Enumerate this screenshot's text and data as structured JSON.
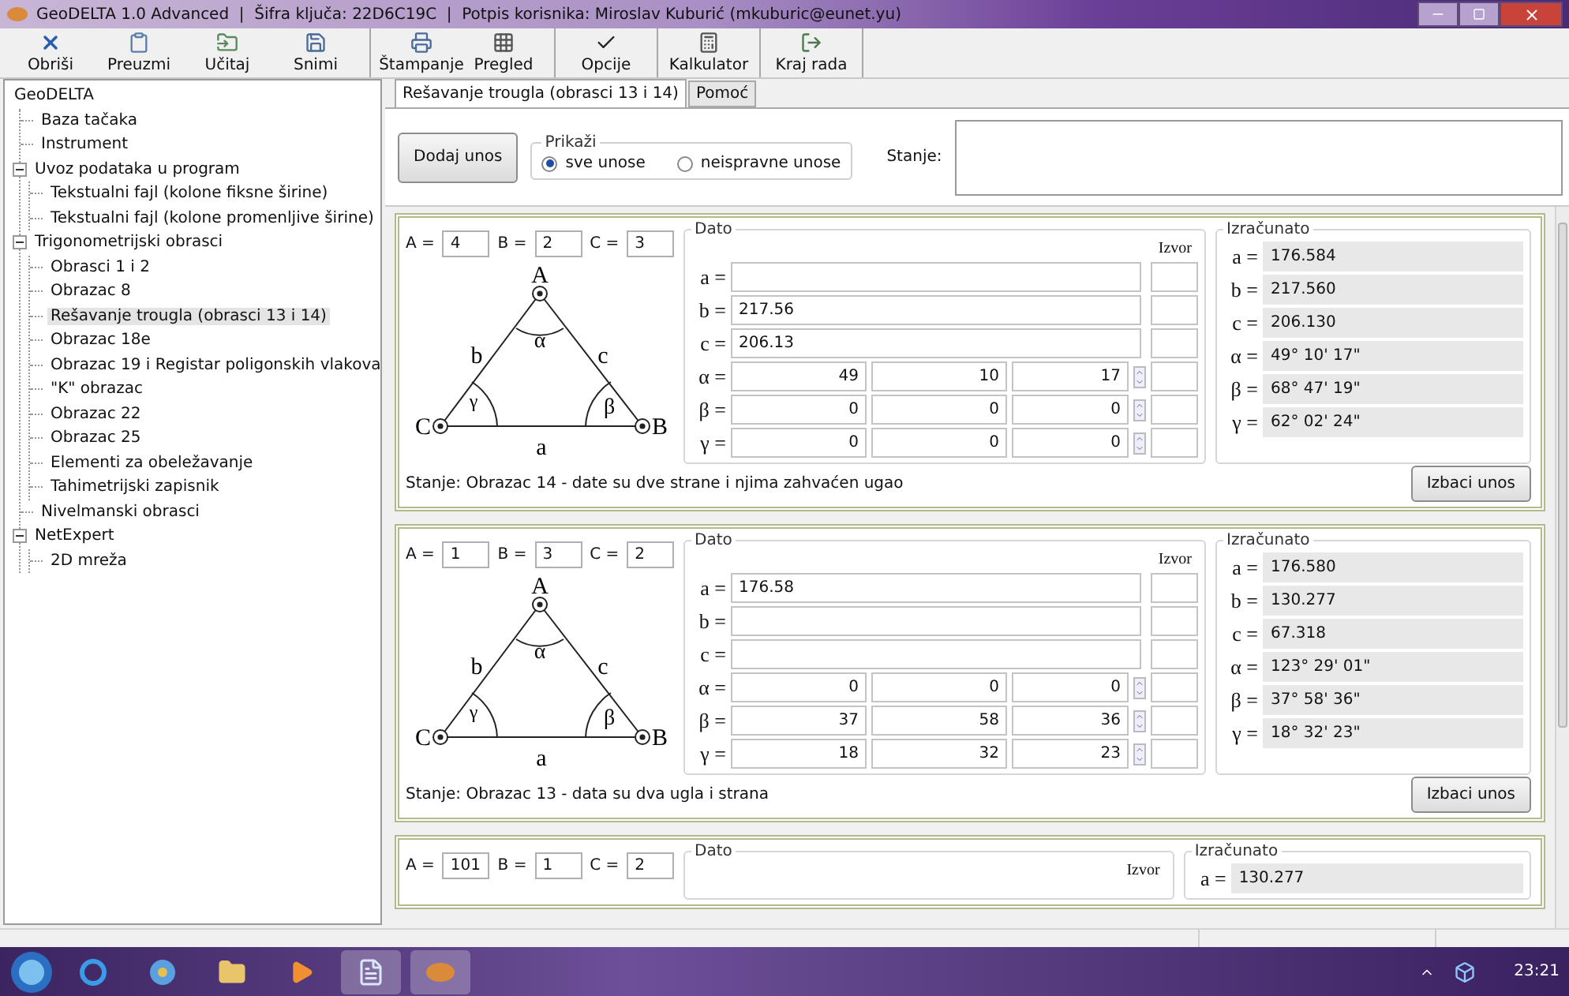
{
  "window": {
    "title": "GeoDELTA 1.0 Advanced  |  Šifra ključa: 22D6C19C  |  Potpis korisnika: Miroslav Kuburić (mkuburic@eunet.yu)"
  },
  "toolbar": {
    "groups": [
      {
        "buttons": [
          "Obriši",
          "Preuzmi",
          "Učitaj",
          "Snimi"
        ]
      },
      {
        "buttons": [
          "Štampanje",
          "Pregled"
        ]
      },
      {
        "buttons": [
          "Opcije"
        ]
      },
      {
        "buttons": [
          "Kalkulator"
        ]
      },
      {
        "buttons": [
          "Kraj rada"
        ]
      }
    ]
  },
  "tree": {
    "root": "GeoDELTA",
    "items": [
      {
        "label": "Baza tačaka",
        "selected": false
      },
      {
        "label": "Instrument",
        "selected": false
      },
      {
        "label": "Uvoz podataka u program",
        "selected": false,
        "expanded": true,
        "children": [
          {
            "label": "Tekstualni fajl (kolone fiksne širine)",
            "selected": false
          },
          {
            "label": "Tekstualni fajl (kolone promenljive širine)",
            "selected": false
          }
        ]
      },
      {
        "label": "Trigonometrijski obrasci",
        "selected": false,
        "expanded": true,
        "children": [
          {
            "label": "Obrasci 1 i 2",
            "selected": false
          },
          {
            "label": "Obrazac 8",
            "selected": false
          },
          {
            "label": "Rešavanje trougla (obrasci 13 i 14)",
            "selected": true
          },
          {
            "label": "Obrazac 18e",
            "selected": false
          },
          {
            "label": "Obrazac 19 i Registar poligonskih vlakova",
            "selected": false
          },
          {
            "label": "\"K\" obrazac",
            "selected": false
          },
          {
            "label": "Obrazac 22",
            "selected": false
          },
          {
            "label": "Obrazac 25",
            "selected": false
          },
          {
            "label": "Elementi za obeležavanje",
            "selected": false
          },
          {
            "label": "Tahimetrijski zapisnik",
            "selected": false
          }
        ]
      },
      {
        "label": "Nivelmanski obrasci",
        "selected": false
      },
      {
        "label": "NetExpert",
        "selected": false,
        "expanded": true,
        "children": [
          {
            "label": "2D mreža",
            "selected": false
          }
        ]
      }
    ]
  },
  "tabs": [
    {
      "label": "Rešavanje trougla (obrasci 13 i 14)",
      "selected": true
    },
    {
      "label": "Pomoć",
      "selected": false
    }
  ],
  "controls": {
    "add_button": "Dodaj unos",
    "show": {
      "legend": "Prikaži",
      "options": [
        {
          "label": "sve unose",
          "selected": true
        },
        {
          "label": "neispravne unose",
          "selected": false
        }
      ]
    },
    "state_label": "Stanje:"
  },
  "cards": [
    {
      "params": [
        {
          "label": "A =",
          "value": "4"
        },
        {
          "label": "B =",
          "value": "2"
        },
        {
          "label": "C =",
          "value": "3"
        }
      ],
      "triangle": {
        "vertices": [
          "A",
          "B",
          "C"
        ],
        "sides": [
          "a",
          "b",
          "c"
        ],
        "angles": [
          "α",
          "β",
          "γ"
        ]
      },
      "given": {
        "title": "Dato",
        "source_header": "Izvor",
        "rows": [
          {
            "label": "a =",
            "kind": "length"
          },
          {
            "label": "b =",
            "kind": "length",
            "value": "217.56"
          },
          {
            "label": "c =",
            "kind": "length",
            "value": "206.13"
          },
          {
            "label": "α =",
            "kind": "angle",
            "values": [
              "49",
              "10",
              "17"
            ]
          },
          {
            "label": "β =",
            "kind": "angle",
            "values": [
              "0",
              "0",
              "0"
            ]
          },
          {
            "label": "γ =",
            "kind": "angle",
            "values": [
              "0",
              "0",
              "0"
            ]
          }
        ]
      },
      "computed": {
        "title": "Izračunato",
        "rows": [
          {
            "label": "a =",
            "value": "176.584"
          },
          {
            "label": "b =",
            "value": "217.560"
          },
          {
            "label": "c =",
            "value": "206.130"
          },
          {
            "label": "α =",
            "value": "49° 10' 17\""
          },
          {
            "label": "β =",
            "value": "68° 47' 19\""
          },
          {
            "label": "γ =",
            "value": "62° 02' 24\""
          }
        ]
      },
      "status": "Stanje:  Obrazac 14 - date su dve strane i njima zahvaćen ugao",
      "remove_button": "Izbaci unos"
    },
    {
      "params": [
        {
          "label": "A =",
          "value": "1"
        },
        {
          "label": "B =",
          "value": "3"
        },
        {
          "label": "C =",
          "value": "2"
        }
      ],
      "triangle": {
        "vertices": [
          "A",
          "B",
          "C"
        ],
        "sides": [
          "a",
          "b",
          "c"
        ],
        "angles": [
          "α",
          "β",
          "γ"
        ]
      },
      "given": {
        "title": "Dato",
        "source_header": "Izvor",
        "rows": [
          {
            "label": "a =",
            "kind": "length",
            "value": "176.58"
          },
          {
            "label": "b =",
            "kind": "length"
          },
          {
            "label": "c =",
            "kind": "length"
          },
          {
            "label": "α =",
            "kind": "angle",
            "values": [
              "0",
              "0",
              "0"
            ]
          },
          {
            "label": "β =",
            "kind": "angle",
            "values": [
              "37",
              "58",
              "36"
            ]
          },
          {
            "label": "γ =",
            "kind": "angle",
            "values": [
              "18",
              "32",
              "23"
            ]
          }
        ]
      },
      "computed": {
        "title": "Izračunato",
        "rows": [
          {
            "label": "a =",
            "value": "176.580"
          },
          {
            "label": "b =",
            "value": "130.277"
          },
          {
            "label": "c =",
            "value": "67.318"
          },
          {
            "label": "α =",
            "value": "123° 29' 01\""
          },
          {
            "label": "β =",
            "value": "37° 58' 36\""
          },
          {
            "label": "γ =",
            "value": "18° 32' 23\""
          }
        ]
      },
      "status": "Stanje:  Obrazac 13 - data su dva ugla i strana",
      "remove_button": "Izbaci unos"
    },
    {
      "params": [
        {
          "label": "A =",
          "value": "101"
        },
        {
          "label": "B =",
          "value": "1"
        },
        {
          "label": "C =",
          "value": "2"
        }
      ],
      "given": {
        "title": "Dato",
        "source_header": "Izvor"
      },
      "computed": {
        "title": "Izračunato",
        "rows": [
          {
            "label": "a =",
            "value": "130.277"
          }
        ]
      }
    }
  ],
  "taskbar": {
    "clock": "23:21"
  }
}
